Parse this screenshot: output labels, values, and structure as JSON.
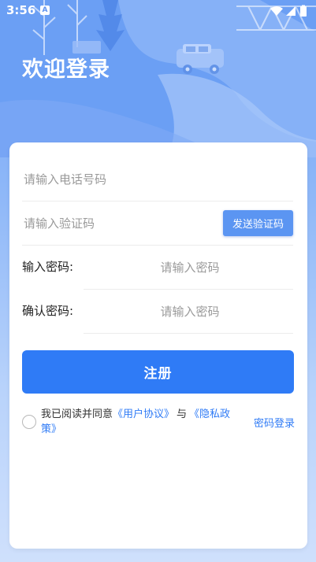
{
  "status_bar": {
    "time": "3:56",
    "notification_badge": "A",
    "icons": [
      "wifi-icon",
      "signal-icon",
      "battery-icon"
    ]
  },
  "header": {
    "title": "欢迎登录"
  },
  "form": {
    "phone_placeholder": "请输入电话号码",
    "code_placeholder": "请输入验证码",
    "send_code_label": "发送验证码",
    "password_label": "输入密码:",
    "password_placeholder": "请输入密码",
    "confirm_label": "确认密码:",
    "confirm_placeholder": "请输入密码",
    "register_label": "注册"
  },
  "agreement": {
    "prefix": "我已阅读并同意",
    "user_agreement": "《用户协议》",
    "conjunction": "与",
    "privacy_policy": "《隐私政策》",
    "checked": false
  },
  "password_login_label": "密码登录",
  "colors": {
    "primary": "#2f7bf6",
    "send_button": "#5b95f2",
    "background_top": "#6fa2f5",
    "background_bottom": "#cfe0fc"
  }
}
